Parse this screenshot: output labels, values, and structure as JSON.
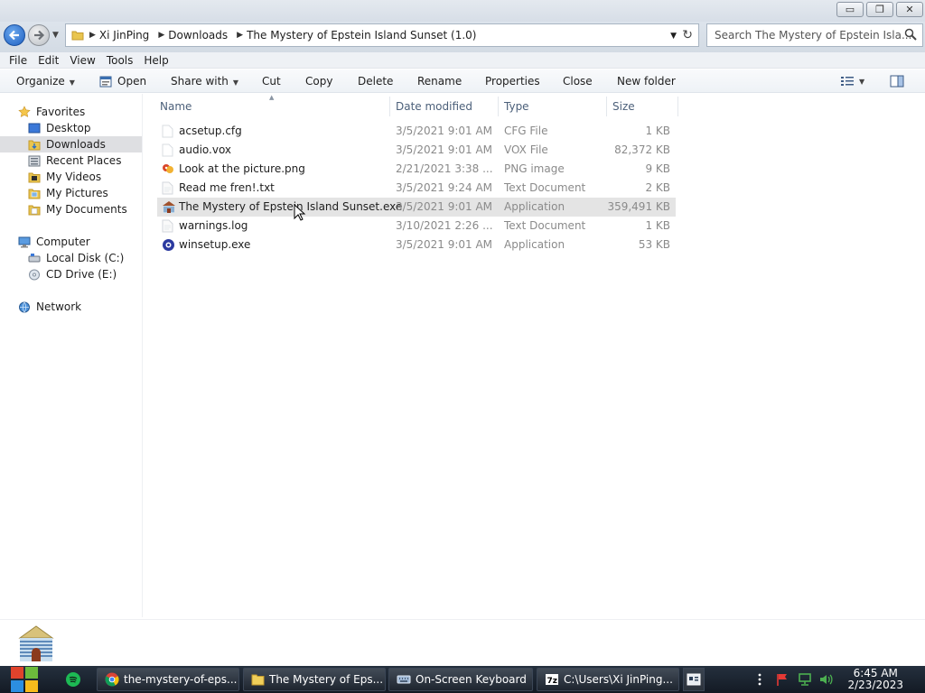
{
  "window": {
    "minimize_glyph": "▭",
    "maximize_glyph": "❐",
    "close_glyph": "✕"
  },
  "address": {
    "crumbs": [
      "Xi JinPing",
      "Downloads",
      "The Mystery of Epstein Island Sunset  (1.0)"
    ],
    "search_placeholder": "Search The Mystery of Epstein Isla..."
  },
  "menu": [
    "File",
    "Edit",
    "View",
    "Tools",
    "Help"
  ],
  "commands": {
    "organize": "Organize",
    "open": "Open",
    "share": "Share with",
    "cut": "Cut",
    "copy": "Copy",
    "delete": "Delete",
    "rename": "Rename",
    "properties": "Properties",
    "close": "Close",
    "new_folder": "New folder"
  },
  "nav": {
    "favorites": "Favorites",
    "favorites_items": [
      "Desktop",
      "Downloads",
      "Recent Places",
      "My Videos",
      "My Pictures",
      "My Documents"
    ],
    "computer": "Computer",
    "computer_items": [
      "Local Disk (C:)",
      "CD Drive (E:)"
    ],
    "network": "Network"
  },
  "columns": {
    "name": "Name",
    "date": "Date modified",
    "type": "Type",
    "size": "Size"
  },
  "files": [
    {
      "name": "acsetup.cfg",
      "date": "3/5/2021 9:01 AM",
      "type": "CFG File",
      "size": "1 KB",
      "icon": "blank-file-icon"
    },
    {
      "name": "audio.vox",
      "date": "3/5/2021 9:01 AM",
      "type": "VOX File",
      "size": "82,372 KB",
      "icon": "blank-file-icon"
    },
    {
      "name": "Look at the picture.png",
      "date": "2/21/2021 3:38 ...",
      "type": "PNG image",
      "size": "9 KB",
      "icon": "image-file-icon"
    },
    {
      "name": "Read me fren!.txt",
      "date": "3/5/2021 9:24 AM",
      "type": "Text Document",
      "size": "2 KB",
      "icon": "text-file-icon"
    },
    {
      "name": "The Mystery of Epstein Island Sunset.exe",
      "date": "3/5/2021 9:01 AM",
      "type": "Application",
      "size": "359,491 KB",
      "icon": "game-exe-icon"
    },
    {
      "name": "warnings.log",
      "date": "3/10/2021 2:26 ...",
      "type": "Text Document",
      "size": "1 KB",
      "icon": "text-file-icon"
    },
    {
      "name": "winsetup.exe",
      "date": "3/5/2021 9:01 AM",
      "type": "Application",
      "size": "53 KB",
      "icon": "setup-exe-icon"
    }
  ],
  "taskbar": {
    "items": [
      "the-mystery-of-eps...",
      "The Mystery of Eps...",
      "On-Screen Keyboard",
      "C:\\Users\\Xi JinPing..."
    ],
    "time": "6:45 AM",
    "date": "2/23/2023"
  },
  "colors": {
    "accent": "#1e5fc1",
    "selection": "#e4e4e4",
    "taskbar": "#1b2430"
  }
}
